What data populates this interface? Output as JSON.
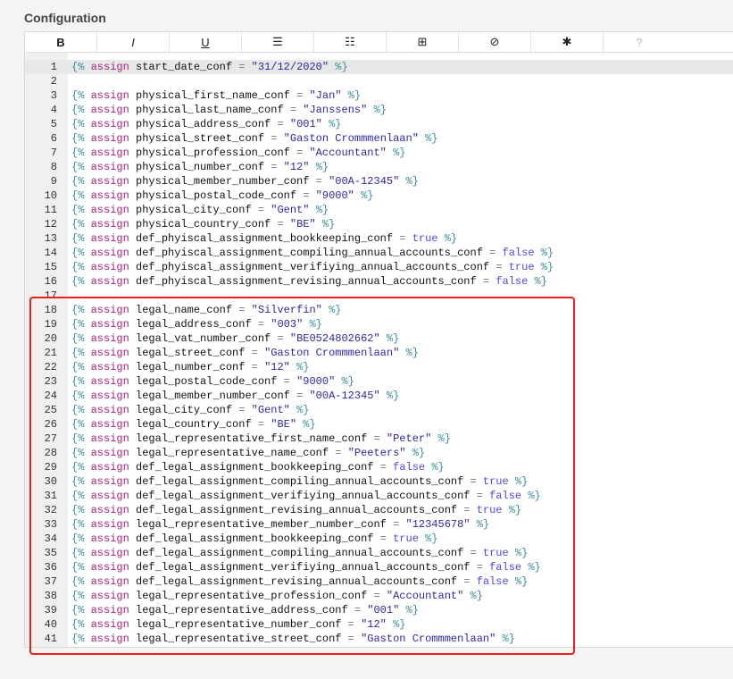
{
  "label": "Configuration",
  "toolbar": [
    {
      "name": "bold-button",
      "glyph": "B"
    },
    {
      "name": "italic-button",
      "glyph": "I"
    },
    {
      "name": "underline-button",
      "glyph": "U"
    },
    {
      "name": "bullet-list-button",
      "glyph": "☰"
    },
    {
      "name": "numbered-list-button",
      "glyph": "☷"
    },
    {
      "name": "table-button",
      "glyph": "⊞"
    },
    {
      "name": "hide-preview-button",
      "glyph": "⊘"
    },
    {
      "name": "debug-button",
      "glyph": "✱"
    },
    {
      "name": "help-button",
      "glyph": "?"
    }
  ],
  "keyword": "assign",
  "lines": [
    {
      "n": 1,
      "var": "start_date_conf",
      "val": "\"31/12/2020\"",
      "t": "str"
    },
    {
      "n": 2
    },
    {
      "n": 3,
      "var": "physical_first_name_conf",
      "val": "\"Jan\"",
      "t": "str"
    },
    {
      "n": 4,
      "var": "physical_last_name_conf",
      "val": "\"Janssens\"",
      "t": "str"
    },
    {
      "n": 5,
      "var": "physical_address_conf",
      "val": "\"001\"",
      "t": "str"
    },
    {
      "n": 6,
      "var": "physical_street_conf",
      "val": "\"Gaston Crommmenlaan\"",
      "t": "str"
    },
    {
      "n": 7,
      "var": "physical_profession_conf",
      "val": "\"Accountant\"",
      "t": "str"
    },
    {
      "n": 8,
      "var": "physical_number_conf",
      "val": "\"12\"",
      "t": "str"
    },
    {
      "n": 9,
      "var": "physical_member_number_conf",
      "val": "\"00A-12345\"",
      "t": "str"
    },
    {
      "n": 10,
      "var": "physical_postal_code_conf",
      "val": "\"9000\"",
      "t": "str"
    },
    {
      "n": 11,
      "var": "physical_city_conf",
      "val": "\"Gent\"",
      "t": "str"
    },
    {
      "n": 12,
      "var": "physical_country_conf",
      "val": "\"BE\"",
      "t": "str"
    },
    {
      "n": 13,
      "var": "def_phyiscal_assignment_bookkeeping_conf",
      "val": "true",
      "t": "bool"
    },
    {
      "n": 14,
      "var": "def_phyiscal_assignment_compiling_annual_accounts_conf",
      "val": "false",
      "t": "bool"
    },
    {
      "n": 15,
      "var": "def_phyiscal_assignment_verifiying_annual_accounts_conf",
      "val": "true",
      "t": "bool"
    },
    {
      "n": 16,
      "var": "def_phyiscal_assignment_revising_annual_accounts_conf",
      "val": "false",
      "t": "bool"
    },
    {
      "n": 17
    },
    {
      "n": 18,
      "var": "legal_name_conf",
      "val": "\"Silverfin\"",
      "t": "str"
    },
    {
      "n": 19,
      "var": "legal_address_conf",
      "val": "\"003\"",
      "t": "str"
    },
    {
      "n": 20,
      "var": "legal_vat_number_conf",
      "val": "\"BE0524802662\"",
      "t": "str"
    },
    {
      "n": 21,
      "var": "legal_street_conf",
      "val": "\"Gaston Crommmenlaan\"",
      "t": "str"
    },
    {
      "n": 22,
      "var": "legal_number_conf",
      "val": "\"12\"",
      "t": "str"
    },
    {
      "n": 23,
      "var": "legal_postal_code_conf",
      "val": "\"9000\"",
      "t": "str"
    },
    {
      "n": 24,
      "var": "legal_member_number_conf",
      "val": "\"00A-12345\"",
      "t": "str"
    },
    {
      "n": 25,
      "var": "legal_city_conf",
      "val": "\"Gent\"",
      "t": "str"
    },
    {
      "n": 26,
      "var": "legal_country_conf",
      "val": "\"BE\"",
      "t": "str"
    },
    {
      "n": 27,
      "var": "legal_representative_first_name_conf",
      "val": "\"Peter\"",
      "t": "str"
    },
    {
      "n": 28,
      "var": "legal_representative_name_conf",
      "val": "\"Peeters\"",
      "t": "str"
    },
    {
      "n": 29,
      "var": "def_legal_assignment_bookkeeping_conf",
      "val": "false",
      "t": "bool"
    },
    {
      "n": 30,
      "var": "def_legal_assignment_compiling_annual_accounts_conf",
      "val": "true",
      "t": "bool"
    },
    {
      "n": 31,
      "var": "def_legal_assignment_verifiying_annual_accounts_conf",
      "val": "false",
      "t": "bool"
    },
    {
      "n": 32,
      "var": "def_legal_assignment_revising_annual_accounts_conf",
      "val": "true",
      "t": "bool"
    },
    {
      "n": 33,
      "var": "legal_representative_member_number_conf",
      "val": "\"12345678\"",
      "t": "str"
    },
    {
      "n": 34,
      "var": "def_legal_assignment_bookkeeping_conf",
      "val": "true",
      "t": "bool"
    },
    {
      "n": 35,
      "var": "def_legal_assignment_compiling_annual_accounts_conf",
      "val": "true",
      "t": "bool"
    },
    {
      "n": 36,
      "var": "def_legal_assignment_verifiying_annual_accounts_conf",
      "val": "false",
      "t": "bool"
    },
    {
      "n": 37,
      "var": "def_legal_assignment_revising_annual_accounts_conf",
      "val": "false",
      "t": "bool"
    },
    {
      "n": 38,
      "var": "legal_representative_profession_conf",
      "val": "\"Accountant\"",
      "t": "str"
    },
    {
      "n": 39,
      "var": "legal_representative_address_conf",
      "val": "\"001\"",
      "t": "str"
    },
    {
      "n": 40,
      "var": "legal_representative_number_conf",
      "val": "\"12\"",
      "t": "str"
    },
    {
      "n": 41,
      "var": "legal_representative_street_conf",
      "val": "\"Gaston Crommmenlaan\"",
      "t": "str"
    }
  ],
  "colors": {
    "highlight": "#e8201c",
    "keyword": "#a8227e",
    "string": "#2a2aa0",
    "boolean": "#4a4ae0",
    "brace": "#3a8c99"
  }
}
